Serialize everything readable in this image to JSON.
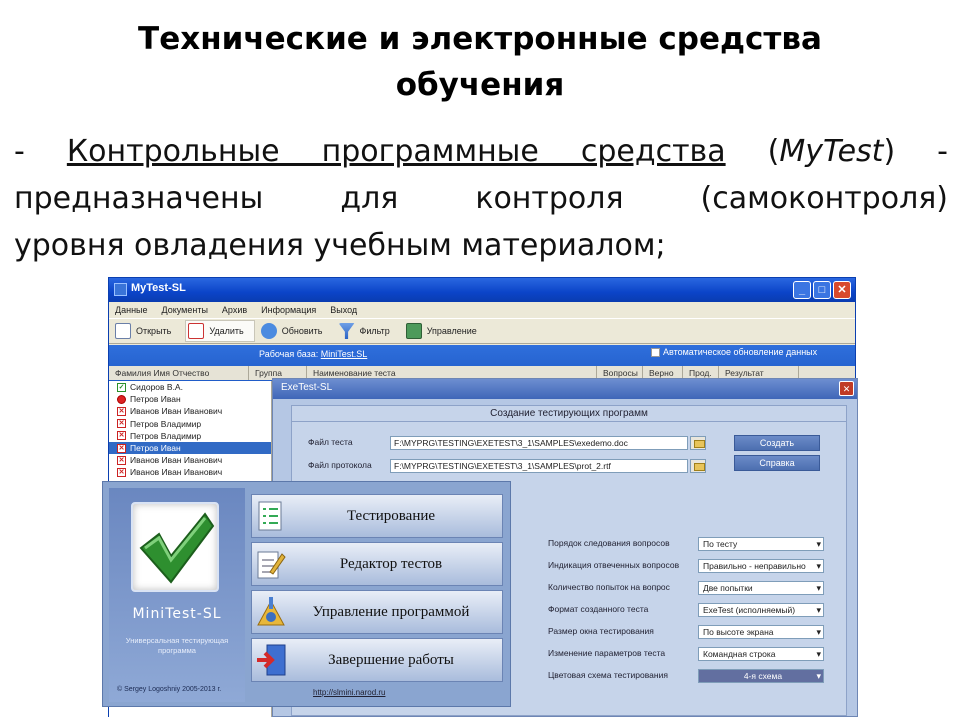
{
  "slide": {
    "title_line1": "Технические и электронные средства",
    "title_line2": "обучения",
    "dash": "- ",
    "term": "Контрольные программные средства",
    "paren_open": " (",
    "product": "MyTest",
    "paren_close": ") -",
    "line2": "предназначены для контроля (самоконтроля)",
    "line3": "уровня овладения учебным материалом;"
  },
  "mytest_window": {
    "title": "MyTest-SL",
    "menu": [
      "Данные",
      "Документы",
      "Архив",
      "Информация",
      "Выход"
    ],
    "toolbar": [
      "Открыть",
      "Удалить",
      "Обновить",
      "Фильтр",
      "Управление"
    ],
    "base_label": "Рабочая база:",
    "base_value": "MiniTest.SL",
    "auto_update_label": "Автоматическое обновление данных",
    "columns": [
      "Фамилия Имя Отчество",
      "Группа",
      "Наименование теста",
      "Вопросы",
      "Верно",
      "Прод.",
      "Результат"
    ],
    "users": [
      {
        "name": "Сидоров В.А.",
        "status": "ok"
      },
      {
        "name": "Петров Иван",
        "status": "stop"
      },
      {
        "name": "Иванов Иван Иванович",
        "status": "bad"
      },
      {
        "name": "Петров Владимир",
        "status": "bad"
      },
      {
        "name": "Петров Владимир",
        "status": "bad"
      },
      {
        "name": "Петров Иван",
        "status": "bad",
        "selected": true
      },
      {
        "name": "Иванов Иван Иванович",
        "status": "bad"
      },
      {
        "name": "Иванов Иван Иванович",
        "status": "bad"
      }
    ]
  },
  "exetest_window": {
    "title": "ExeTest-SL",
    "header": "Создание тестирующих программ",
    "test_file_label": "Файл теста",
    "test_file_value": "F:\\MYPRG\\TESTING\\EXETEST\\3_1\\SAMPLES\\exedemo.doc",
    "protocol_file_label": "Файл протокола",
    "protocol_file_value": "F:\\MYPRG\\TESTING\\EXETEST\\3_1\\SAMPLES\\prot_2.rtf",
    "create_button": "Создать",
    "help_button": "Справка",
    "settings": [
      {
        "label": "Порядок следования вопросов",
        "value": "По тесту"
      },
      {
        "label": "Индикация отвеченных вопросов",
        "value": "Правильно - неправильно"
      },
      {
        "label": "Количество попыток на вопрос",
        "value": "Две попытки"
      },
      {
        "label": "Формат созданного теста",
        "value": "ExeTest (исполняемый)"
      },
      {
        "label": "Размер окна тестирования",
        "value": "По высоте экрана"
      },
      {
        "label": "Изменение параметров теста",
        "value": "Командная строка"
      },
      {
        "label": "Цветовая схема тестирования",
        "value": "4-я схема"
      }
    ]
  },
  "minitest_window": {
    "app_name": "MiniTest-SL",
    "subtitle": "Универсальная тестирующая программа",
    "copyright": "© Sergey Logoshniy 2005-2013 г.",
    "url": "http://slmini.narod.ru",
    "buttons": [
      "Тестирование",
      "Редактор тестов",
      "Управление программой",
      "Завершение работы"
    ]
  }
}
